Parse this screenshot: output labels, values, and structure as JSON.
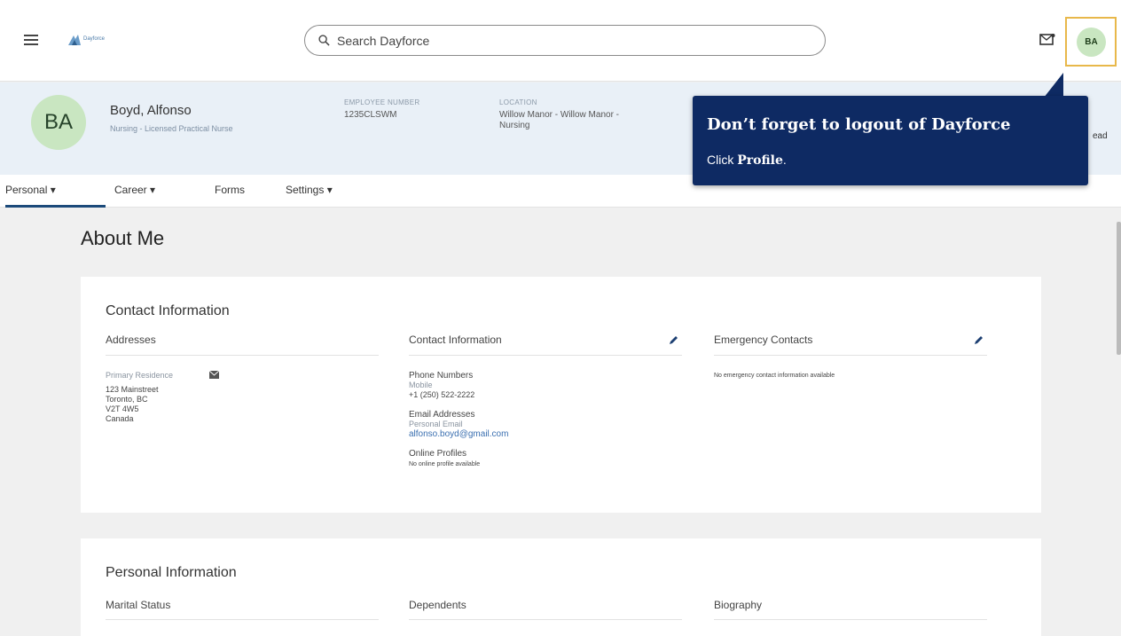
{
  "header": {
    "logo_text": "Dayforce",
    "search_placeholder": "Search Dayforce",
    "avatar_initials": "BA",
    "accent_color": "#e8b84a"
  },
  "employee": {
    "initials": "BA",
    "name": "Boyd, Alfonso",
    "subtitle": "Nursing - Licensed Practical Nurse",
    "employee_number_label": "EMPLOYEE NUMBER",
    "employee_number": "1235CLSWM",
    "location_label": "LOCATION",
    "location_line1": "Willow Manor - Willow Manor -",
    "location_line2": "Nursing",
    "truncated_text": "ead"
  },
  "tabs": [
    {
      "label": "Personal ▾"
    },
    {
      "label": "Career ▾"
    },
    {
      "label": "Forms"
    },
    {
      "label": "Settings ▾"
    }
  ],
  "page_title": "About Me",
  "contact_card": {
    "title": "Contact Information",
    "addresses": {
      "heading": "Addresses",
      "type": "Primary Residence",
      "line1": "123 Mainstreet",
      "line2": "Toronto, BC",
      "line3": "V2T 4W5",
      "line4": "Canada"
    },
    "contact": {
      "heading": "Contact Information",
      "phone_heading": "Phone Numbers",
      "phone_type": "Mobile",
      "phone": "+1 (250) 522-2222",
      "email_heading": "Email Addresses",
      "email_type": "Personal Email",
      "email": "alfonso.boyd@gmail.com",
      "profiles_heading": "Online Profiles",
      "profiles_value": "No online profile available"
    },
    "emergency": {
      "heading": "Emergency Contacts",
      "value": "No emergency contact information available"
    }
  },
  "personal_card": {
    "title": "Personal Information",
    "marital_heading": "Marital Status",
    "dependents_heading": "Dependents",
    "biography_heading": "Biography"
  },
  "tooltip": {
    "title": "Don’t forget to logout of Dayforce",
    "body_prefix": "Click ",
    "body_strong": "Profile",
    "body_suffix": ".",
    "color": "#0e2a63"
  }
}
